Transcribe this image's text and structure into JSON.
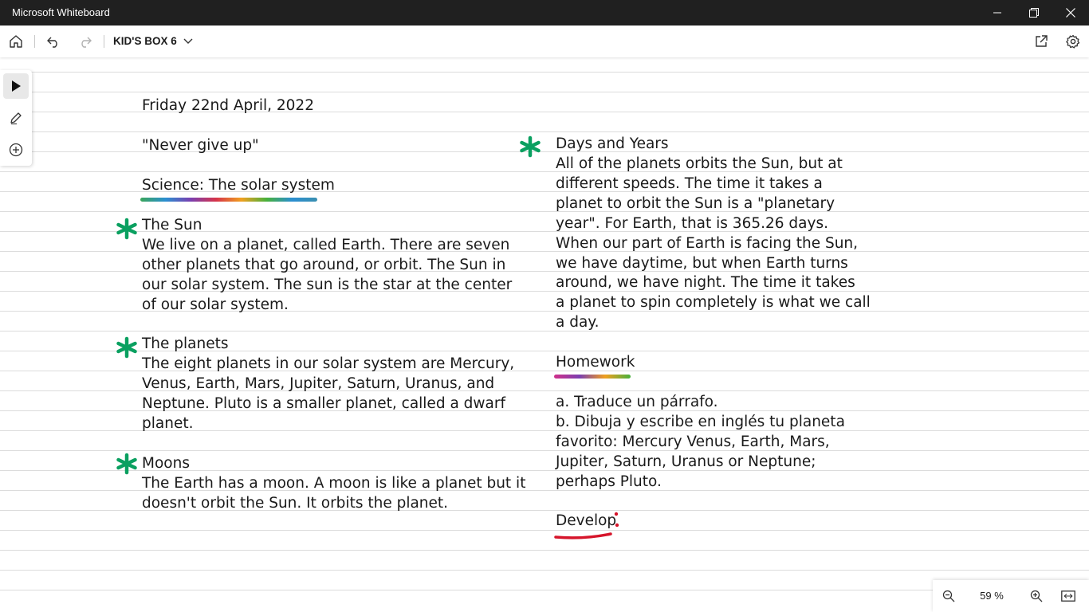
{
  "window": {
    "title": "Microsoft Whiteboard"
  },
  "toolbar": {
    "board_name": "KID'S BOX 6"
  },
  "zoom": {
    "level": "59 %"
  },
  "accent_colors": {
    "star": "#0aa060",
    "develop_underline": "#d6152b"
  },
  "board": {
    "date": "Friday 22nd April, 2022",
    "motto": "\"Never  give up\"",
    "subject": "Science: The solar system",
    "sun": {
      "title": "The Sun",
      "lines": [
        "We live on a planet, called Earth. There are seven",
        "other planets that go around, or orbit. The Sun in",
        "our solar system. The sun is the star at the center",
        "of our solar system."
      ]
    },
    "planets": {
      "title": "The planets",
      "lines": [
        "The eight planets in our solar system are Mercury,",
        "Venus, Earth, Mars, Jupiter, Saturn, Uranus, and",
        "Neptune. Pluto is a smaller planet, called a dwarf",
        "planet."
      ]
    },
    "moons": {
      "title": "Moons",
      "lines": [
        "The Earth has a moon. A moon is like a planet but it",
        "doesn't orbit the Sun. It orbits the planet."
      ]
    },
    "days": {
      "title": "Days and Years",
      "lines": [
        "All of the planets orbits the Sun, but at",
        "different speeds. The time it takes a",
        "planet to orbit the Sun is a \"planetary",
        "year\". For Earth, that is 365.26 days.",
        "When our part of Earth is facing the Sun,",
        "we have daytime, but when Earth turns",
        "around, we have night. The time it takes",
        "a planet to spin completely is what we call",
        "a day."
      ]
    },
    "homework": {
      "title": "Homework",
      "lines": [
        "a. Traduce un párrafo.",
        "b. Dibuja y escribe en inglés tu planeta",
        "favorito: Mercury Venus, Earth, Mars,",
        "Jupiter, Saturn, Uranus or Neptune;",
        "perhaps Pluto."
      ]
    },
    "develop": {
      "title": "Develop"
    }
  }
}
